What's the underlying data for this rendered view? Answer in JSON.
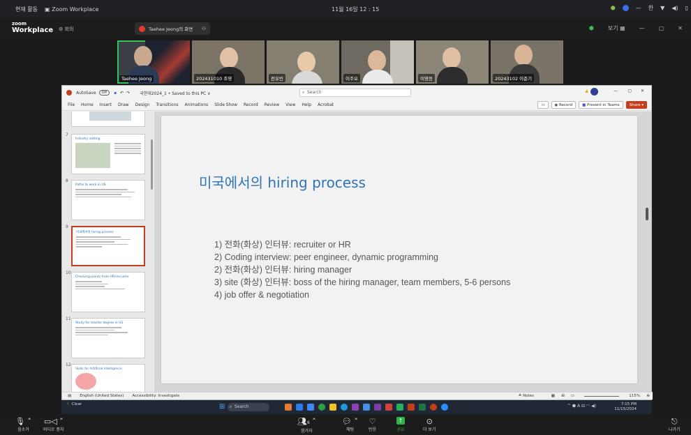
{
  "os": {
    "left_label": "현재 활동",
    "app_label": "Zoom Workplace",
    "clock": "11월 16일 12 : 15"
  },
  "zoom": {
    "logo_top": "zoom",
    "logo_bottom": "Workplace",
    "left_label": "회의",
    "tab_label": "Taehee Jeong의 화면",
    "view_label": "보기"
  },
  "participants": [
    {
      "name": "Taehee Jeong",
      "active": true
    },
    {
      "name": "202431010 조영",
      "active": false
    },
    {
      "name": "전유빈",
      "active": false
    },
    {
      "name": "이주오",
      "active": false
    },
    {
      "name": "이영응",
      "active": false
    },
    {
      "name": "20243102 이준기",
      "active": false
    }
  ],
  "ppt": {
    "autosave": "AutoSave",
    "autosave_state": "Off",
    "filename": "국한대2024_1 • Saved to this PC ∨",
    "search_placeholder": "Search",
    "menu": [
      "File",
      "Home",
      "Insert",
      "Draw",
      "Design",
      "Transitions",
      "Animations",
      "Slide Show",
      "Record",
      "Review",
      "View",
      "Help",
      "Acrobat"
    ],
    "record_btn": "Record",
    "present_btn": "Present in Teams",
    "share_btn": "Share",
    "thumbs": [
      {
        "num": "7",
        "title": "Industry setting",
        "selected": false
      },
      {
        "num": "8",
        "title": "Paths to work in US",
        "selected": false
      },
      {
        "num": "9",
        "title": "미국에서의 hiring process",
        "selected": true
      },
      {
        "num": "10",
        "title": "Checking points from HR/recruiter",
        "selected": false
      },
      {
        "num": "11",
        "title": "Study for master degree in US",
        "selected": false
      },
      {
        "num": "12",
        "title": "Skills for Artificial Intelligence",
        "selected": false
      }
    ],
    "slide_title": "미국에서의 hiring process",
    "bullets": [
      "1) 전화(화상) 인터뷰: recruiter or HR",
      "2) Coding interview: peer engineer, dynamic programming",
      "2) 전화(화상) 인터뷰: hiring manager",
      "3) site (화상) 인터뷰: boss of the hiring manager, team members, 5-6 persons",
      "4) job offer & negotiation"
    ],
    "status_language": "English (United States)",
    "status_accessibility": "Accessibility: Investigate",
    "status_notes": "Notes",
    "status_zoom": "115%"
  },
  "taskbar": {
    "weather": "Clear",
    "search": "Search",
    "time": "7:15 PM",
    "date": "11/15/2024"
  },
  "zoom_bar": {
    "audio": "음소거",
    "video": "비디오 중지",
    "participants": "참가자",
    "participants_count": "6",
    "chat": "채팅",
    "react": "반응",
    "share": "공유",
    "more": "더 보기",
    "leave": "나가기"
  }
}
